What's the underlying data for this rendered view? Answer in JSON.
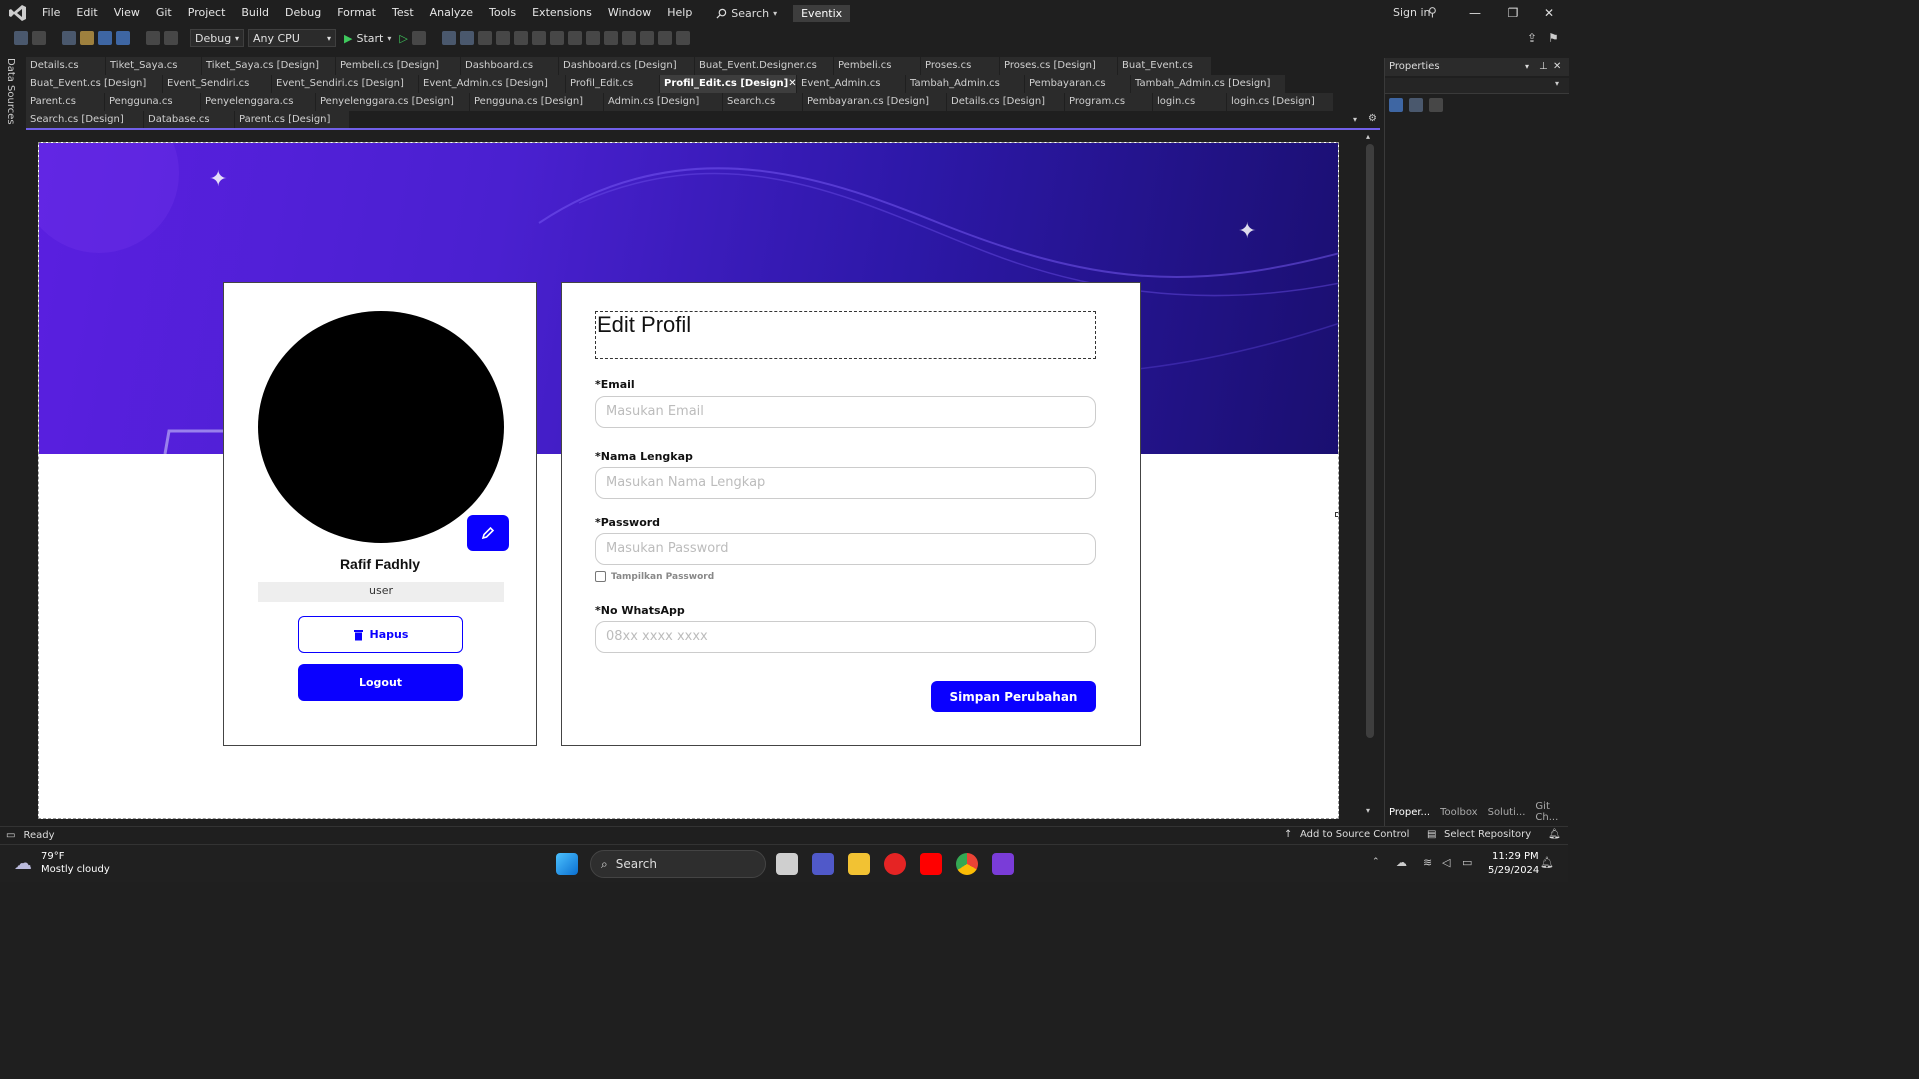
{
  "menu": {
    "items": [
      "File",
      "Edit",
      "View",
      "Git",
      "Project",
      "Build",
      "Debug",
      "Format",
      "Test",
      "Analyze",
      "Tools",
      "Extensions",
      "Window",
      "Help"
    ],
    "search_label": "Search",
    "solution_title": "Eventix",
    "sign_in": "Sign in"
  },
  "toolbar": {
    "config": "Debug",
    "platform": "Any CPU",
    "start_label": "Start"
  },
  "sidebar_label": "Data Sources",
  "tabs": {
    "row1": [
      "Details.cs",
      "Tiket_Saya.cs",
      "Tiket_Saya.cs [Design]",
      "Pembeli.cs [Design]",
      "Dashboard.cs",
      "Dashboard.cs [Design]",
      "Buat_Event.Designer.cs",
      "Pembeli.cs",
      "Proses.cs",
      "Proses.cs [Design]",
      "Buat_Event.cs"
    ],
    "row2": [
      "Buat_Event.cs [Design]",
      "Event_Sendiri.cs",
      "Event_Sendiri.cs [Design]",
      "Event_Admin.cs [Design]",
      "Profil_Edit.cs",
      "Profil_Edit.cs [Design]",
      "Event_Admin.cs",
      "Tambah_Admin.cs",
      "Pembayaran.cs",
      "Tambah_Admin.cs [Design]"
    ],
    "row3": [
      "Parent.cs",
      "Pengguna.cs",
      "Penyelenggara.cs",
      "Penyelenggara.cs [Design]",
      "Pengguna.cs [Design]",
      "Admin.cs [Design]",
      "Search.cs",
      "Pembayaran.cs [Design]",
      "Details.cs [Design]",
      "Program.cs",
      "login.cs",
      "login.cs [Design]"
    ],
    "row4": [
      "Search.cs [Design]",
      "Database.cs",
      "Parent.cs [Design]"
    ],
    "active": "Profil_Edit.cs [Design]"
  },
  "profile": {
    "name": "Rafif Fadhly",
    "role": "user",
    "delete_label": "Hapus",
    "logout_label": "Logout"
  },
  "form": {
    "title": "Edit Profil",
    "email_label": "*Email",
    "email_placeholder": "Masukan Email",
    "name_label": "*Nama Lengkap",
    "name_placeholder": "Masukan Nama Lengkap",
    "password_label": "*Password",
    "password_placeholder": "Masukan Password",
    "show_password": "Tampilkan Password",
    "whatsapp_label": "*No WhatsApp",
    "whatsapp_placeholder": "08xx xxxx xxxx",
    "save_label": "Simpan Perubahan"
  },
  "properties": {
    "title": "Properties",
    "bottom_tabs": [
      "Proper...",
      "Toolbox",
      "Soluti...",
      "Git Ch..."
    ]
  },
  "status": {
    "text": "Ready",
    "source_control": "Add to Source Control",
    "repo": "Select Repository"
  },
  "taskbar": {
    "weather_temp": "79°F",
    "weather_desc": "Mostly cloudy",
    "search_label": "Search",
    "time": "11:29 PM",
    "date": "5/29/2024"
  },
  "colors": {
    "accent": "#0a00ff",
    "banner_start": "#5a1fe0",
    "banner_end": "#1a0f70",
    "vs_purple": "#7160e8"
  }
}
